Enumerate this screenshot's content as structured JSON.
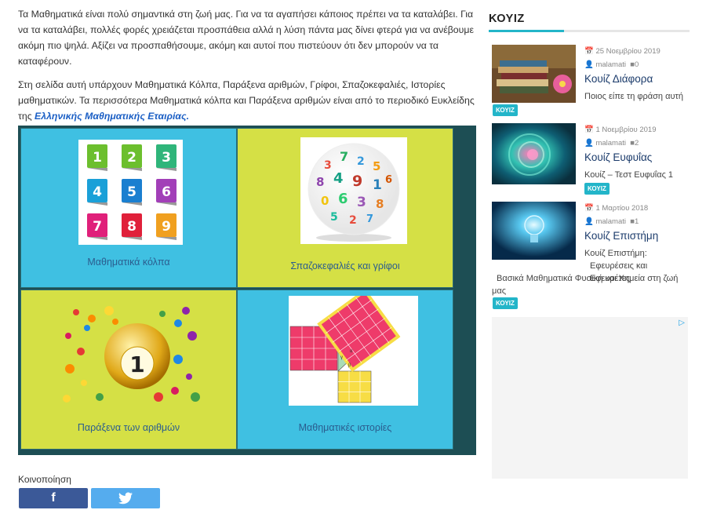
{
  "main": {
    "para1": "Τα Μαθηματικά είναι πολύ σημαντικά στη ζωή μας. Για να τα αγαπήσει κάποιος πρέπει να τα καταλάβει. Για να τα καταλάβει, πολλές φορές χρειάζεται προσπάθεια αλλά η λύση πάντα μας δίνει φτερά για να ανέβουμε ακόμη πιο ψηλά. Αξίζει να προσπαθήσουμε, ακόμη και αυτοί που πιστεύουν ότι δεν μπορούν να τα καταφέρουν.",
    "para2_text": "Στη σελίδα αυτή υπάρχουν Μαθηματικά Κόλπα, Παράξενα αριθμών, Γρίφοι, Σπαζοκεφαλιές, Ιστορίες μαθηματικών. Τα περισσότερα Μαθηματικά κόλπα και Παράξενα αριθμών είναι από το περιοδικό Ευκλείδης της ",
    "para2_link": "Ελληνικής Μαθηματικής Εταιρίας.",
    "tiles": [
      {
        "label": "Μαθηματικά κόλπα"
      },
      {
        "label": "Σπαζοκεφαλιές και γρίφοι"
      },
      {
        "label": "Παράξενα των αριθμών"
      },
      {
        "label": "Μαθηματικές ιστορίες"
      }
    ],
    "numbers_grid": [
      "1",
      "2",
      "3",
      "4",
      "5",
      "6",
      "7",
      "8",
      "9"
    ],
    "ball_number": "1",
    "share_title": "Κοινοποίηση",
    "share_fb": "f",
    "share_tw_icon": "twitter-bird"
  },
  "sidebar": {
    "title": "ΚΟΥΙΖ",
    "posts": [
      {
        "date": "25 Νοεμβρίου 2019",
        "author": "malamati",
        "comments": "0",
        "title": "Κουίζ Διάφορα",
        "excerpt": "Ποιος είπε τη φράση αυτή",
        "badge": "ΚΟΥΙΖ"
      },
      {
        "date": "1 Νοεμβρίου 2019",
        "author": "malamati",
        "comments": "2",
        "title": "Κουίζ Ευφυΐας",
        "excerpt": "Κουίζ – Τεστ Ευφυΐας 1",
        "badge": "ΚΟΥΙΖ"
      },
      {
        "date": "1 Μαρτίου 2018",
        "author": "malamati",
        "comments": "1",
        "title": "Κουίζ Επιστήμη",
        "excerpt_line1": "Κουίζ Επιστήμη:",
        "excerpt_line2": "Εφευρέσεις και Εφευρέτες",
        "excerpt_line3": "Βασικά Μαθηματικά  Φυσική και Χημεία στη ζωή μας",
        "badge": "ΚΟΥΙΖ"
      }
    ]
  },
  "colors": {
    "accent": "#23b5c9",
    "tile_blue": "#3fc0e2",
    "tile_lime": "#d5e045",
    "grid_border": "#1d4e54",
    "facebook": "#3b5998",
    "twitter": "#55acee"
  }
}
